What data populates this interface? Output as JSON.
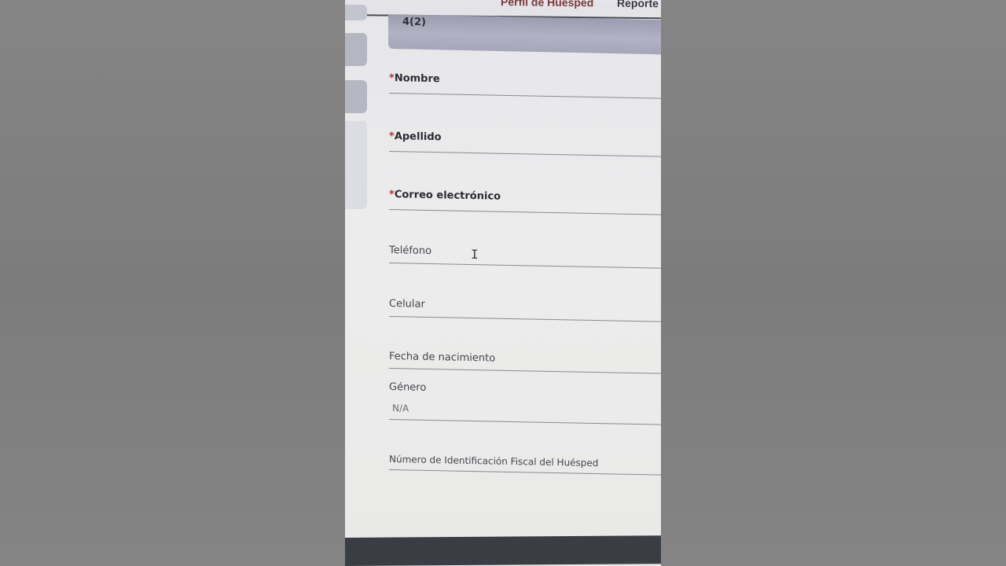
{
  "nav": {
    "guest_profile": "Perfil de Huésped",
    "reports": "Reporte"
  },
  "header": {
    "title": "4(2)"
  },
  "form": {
    "required_mark": "*",
    "nombre": "Nombre",
    "apellido": "Apellido",
    "correo": "Correo electrónico",
    "telefono": "Teléfono",
    "celular": "Celular",
    "fecha_nacimiento": "Fecha de nacimiento",
    "genero": "Género",
    "genero_value": "N/A",
    "nif": "Número de Identificación Fiscal del Huésped"
  },
  "colors": {
    "required": "#c22a2a",
    "header_band": "#a6a6ba",
    "bottom_bar": "#3a3d44"
  }
}
